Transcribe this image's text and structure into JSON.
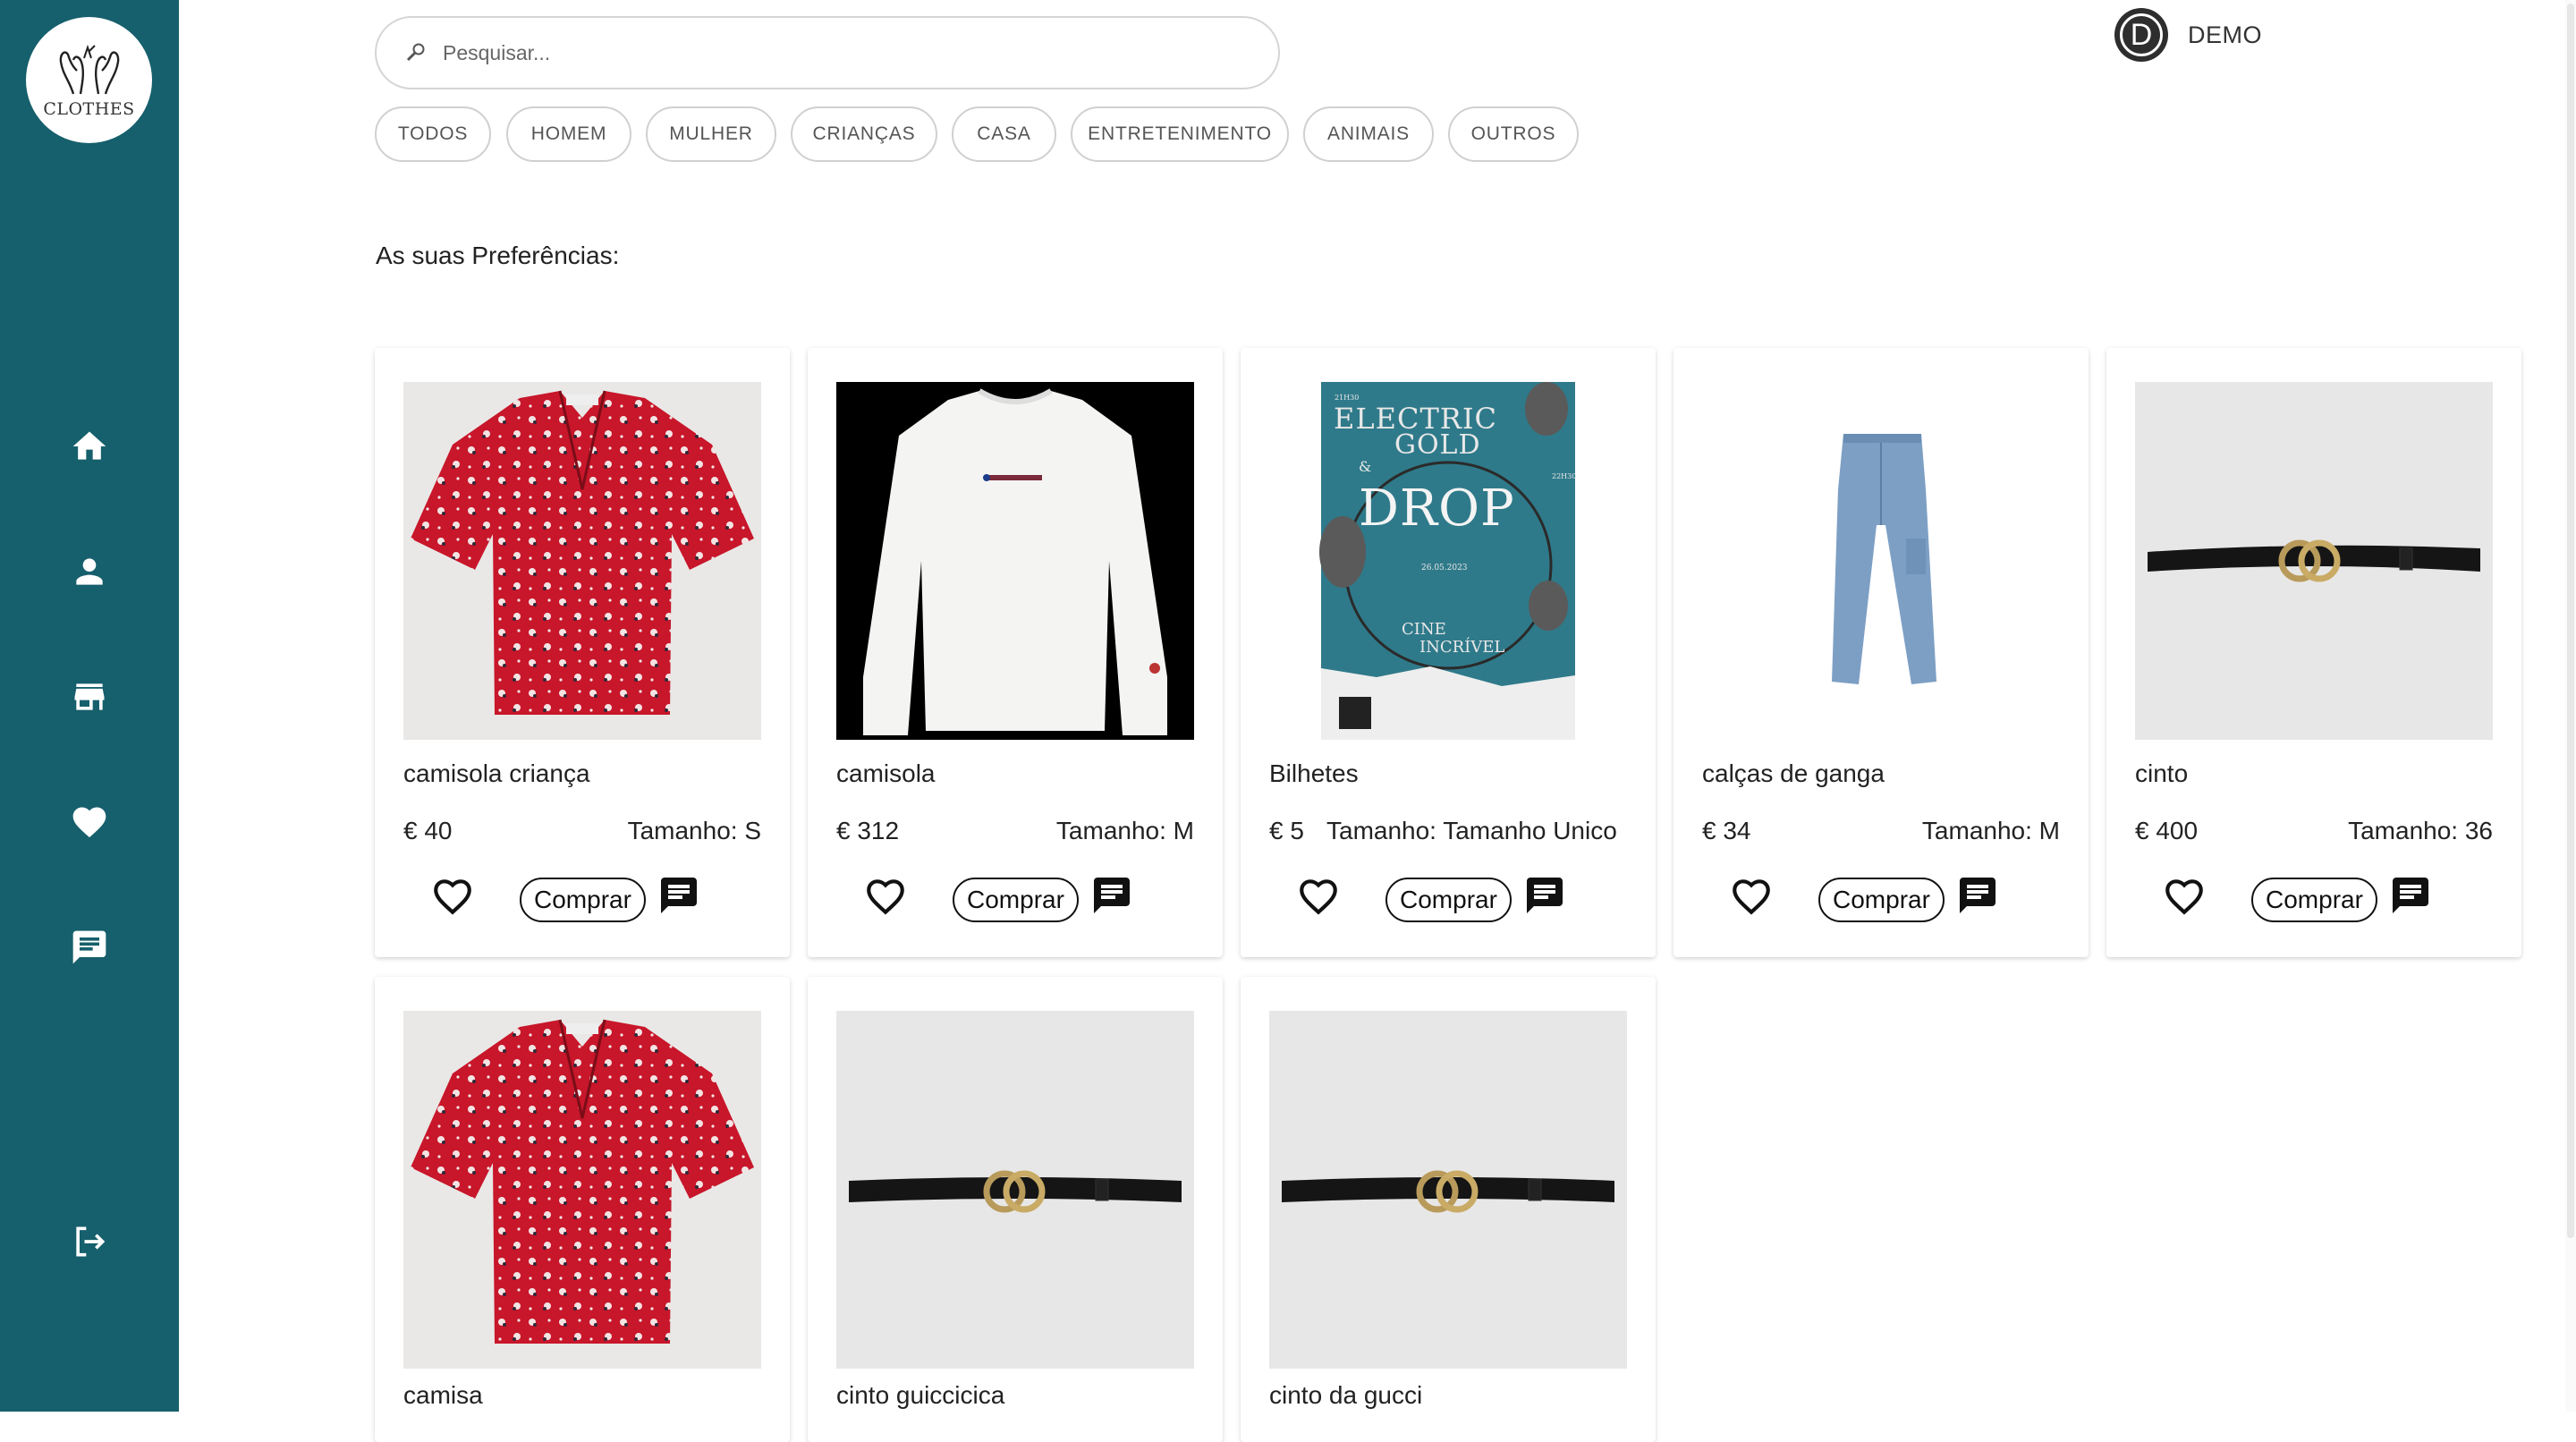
{
  "sidebar": {
    "logo_text": "CLOTHES",
    "nav": [
      {
        "icon": "home-icon"
      },
      {
        "icon": "person-icon"
      },
      {
        "icon": "store-icon"
      },
      {
        "icon": "heart-icon"
      },
      {
        "icon": "chat-icon"
      },
      {
        "icon": "logout-icon"
      }
    ],
    "color": "#165f6c"
  },
  "search": {
    "placeholder": "Pesquisar..."
  },
  "categories": [
    "TODOS",
    "HOMEM",
    "MULHER",
    "CRIANÇAS",
    "CASA",
    "ENTRETENIMENTO",
    "ANIMAIS",
    "OUTROS"
  ],
  "user": {
    "initial": "D",
    "name": "DEMO"
  },
  "section_title": "As suas Preferências:",
  "labels": {
    "buy": "Comprar"
  },
  "products": [
    {
      "name": "camisola criança",
      "price": "€ 40",
      "size": "Tamanho: S",
      "image": "red-floral-blouse"
    },
    {
      "name": "camisola",
      "price": "€ 312",
      "size": "Tamanho: M",
      "image": "white-sweatshirt"
    },
    {
      "name": "Bilhetes",
      "price": "€ 5",
      "size": "Tamanho: Tamanho Unico",
      "image": "concert-poster",
      "poster": {
        "line1": "ELECTRIC",
        "line2": "GOLD",
        "amp": "&",
        "line3": "DROP",
        "date": "26.05.2023",
        "venue1": "CINE",
        "venue2": "INCRÍVEL",
        "time1": "21H30",
        "time2": "22H30"
      }
    },
    {
      "name": "calças de ganga",
      "price": "€ 34",
      "size": "Tamanho: M",
      "image": "jeans"
    },
    {
      "name": "cinto",
      "price": "€ 400",
      "size": "Tamanho: 36",
      "image": "belt"
    },
    {
      "name": "camisa",
      "image": "red-floral-blouse"
    },
    {
      "name": "cinto guiccicica",
      "image": "belt"
    },
    {
      "name": "cinto da gucci",
      "image": "belt"
    }
  ]
}
